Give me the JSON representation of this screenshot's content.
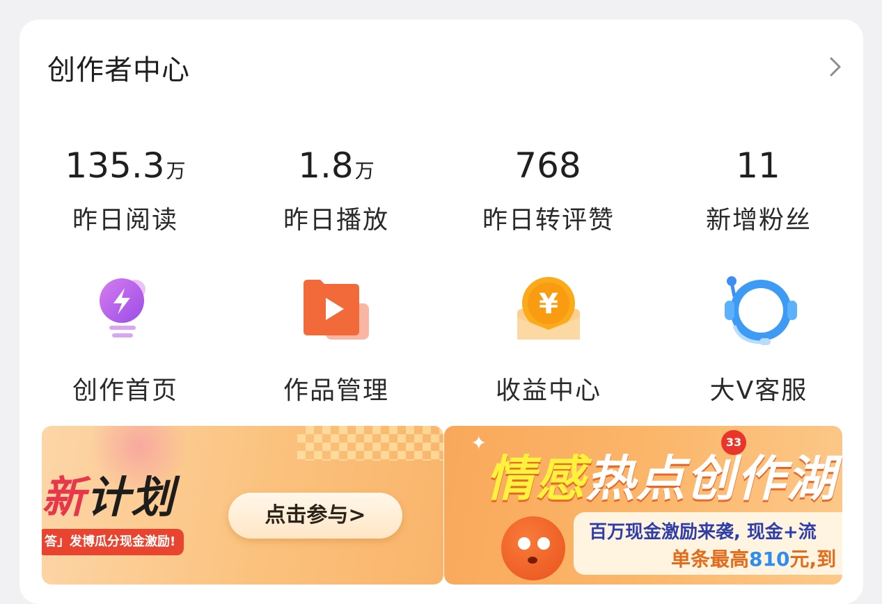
{
  "header": {
    "title": "创作者中心",
    "chevron_icon": "chevron-right-icon"
  },
  "stats": [
    {
      "value": "135.3",
      "unit": "万",
      "label": "昨日阅读"
    },
    {
      "value": "1.8",
      "unit": "万",
      "label": "昨日播放"
    },
    {
      "value": "768",
      "unit": "",
      "label": "昨日转评赞"
    },
    {
      "value": "11",
      "unit": "",
      "label": "新增粉丝"
    }
  ],
  "tools": [
    {
      "icon": "lightbulb-bolt-icon",
      "label": "创作首页"
    },
    {
      "icon": "folder-play-icon",
      "label": "作品管理"
    },
    {
      "icon": "yuan-coin-icon",
      "label": "收益中心"
    },
    {
      "icon": "customer-service-headset-icon",
      "label": "大V客服"
    }
  ],
  "banners": [
    {
      "plan_prefix": "新",
      "plan_rest": "计划",
      "cta": "点击参与>",
      "subtitle": "答」发博瓜分现金激励!"
    },
    {
      "headline_a": "情感",
      "headline_b": "热点创作",
      "headline_c": "湖",
      "badge": "33",
      "line1": "百万现金激励来袭, 现金+流",
      "line2_a": "单条最高",
      "line2_b": "810",
      "line2_c": "元,到"
    }
  ],
  "colors": {
    "accent_orange": "#f97b3a",
    "banner_red": "#e9442f",
    "link_blue": "#2f8df0"
  }
}
